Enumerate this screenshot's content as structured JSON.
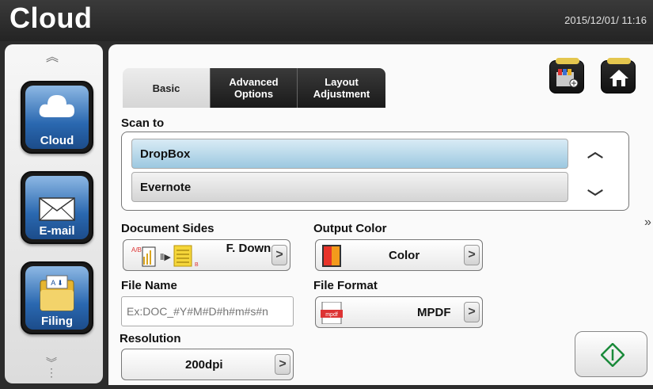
{
  "header": {
    "title": "Cloud",
    "datetime": "2015/12/01/ 11:16"
  },
  "sidebar": {
    "items": [
      {
        "label": "Cloud",
        "icon": "cloud-icon"
      },
      {
        "label": "E-mail",
        "icon": "envelope-icon"
      },
      {
        "label": "Filing",
        "icon": "folder-icon"
      }
    ]
  },
  "tabs": {
    "basic": "Basic",
    "advanced": "Advanced Options",
    "layout": "Layout Adjustment"
  },
  "scan_to": {
    "label": "Scan to",
    "options": [
      "DropBox",
      "Evernote"
    ],
    "selected": "DropBox"
  },
  "document_sides": {
    "label": "Document Sides",
    "value": "F. Down"
  },
  "output_color": {
    "label": "Output Color",
    "value": "Color"
  },
  "file_name": {
    "label": "File Name",
    "placeholder": "Ex:DOC_#Y#M#D#h#m#s#n"
  },
  "file_format": {
    "label": "File Format",
    "value": "MPDF",
    "icon_text": "mpdf"
  },
  "resolution": {
    "label": "Resolution",
    "value": "200dpi"
  },
  "colors": {
    "accent": "#2a68b0",
    "selected_row": "#9cc8e0",
    "start_icon": "#1a8a3a"
  }
}
